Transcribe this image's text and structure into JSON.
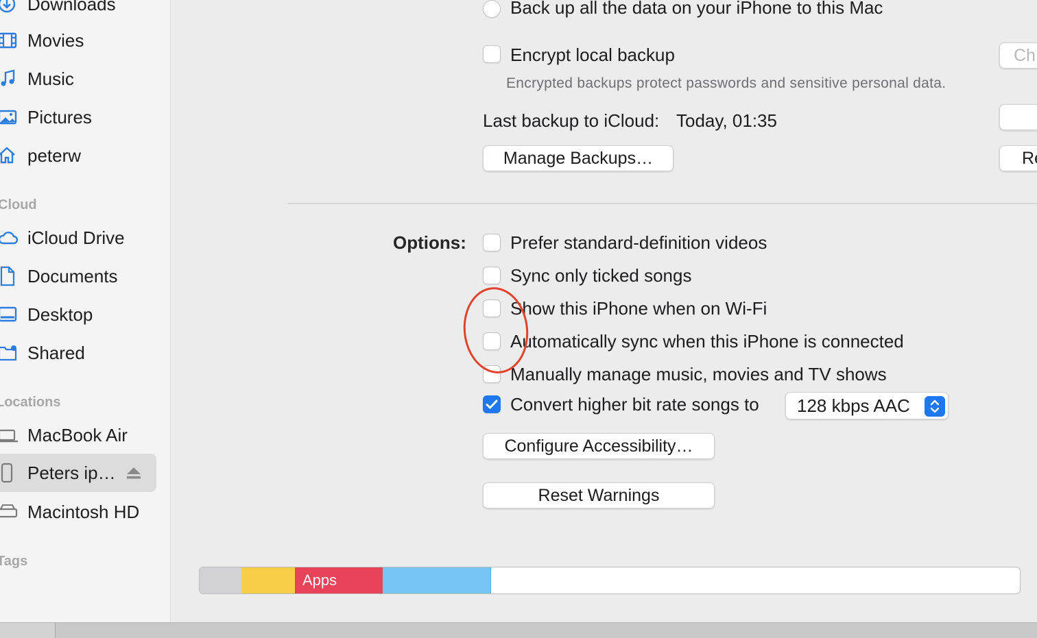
{
  "sidebar": {
    "items": [
      {
        "label": "Downloads",
        "icon": "download-icon"
      },
      {
        "label": "Movies",
        "icon": "film-icon"
      },
      {
        "label": "Music",
        "icon": "music-note-icon"
      },
      {
        "label": "Pictures",
        "icon": "photo-icon"
      },
      {
        "label": "peterw",
        "icon": "home-icon"
      }
    ],
    "cloud_header": "Cloud",
    "cloud_items": [
      {
        "label": "iCloud Drive",
        "icon": "cloud-icon"
      },
      {
        "label": "Documents",
        "icon": "document-icon"
      },
      {
        "label": "Desktop",
        "icon": "desktop-icon"
      },
      {
        "label": "Shared",
        "icon": "shared-folder-icon"
      }
    ],
    "locations_header": "Locations",
    "location_items": [
      {
        "label": "MacBook Air",
        "icon": "laptop-icon"
      },
      {
        "label": "Peters ip…",
        "icon": "iphone-icon",
        "selected": true
      },
      {
        "label": "Macintosh HD",
        "icon": "hard-drive-icon"
      }
    ],
    "tags_header": "Tags"
  },
  "backup": {
    "backup_mac_label": "Back up all the data on your iPhone to this Mac",
    "encrypt_label": "Encrypt local backup",
    "encrypt_desc": "Encrypted backups protect passwords and sensitive personal data.",
    "change_password_label": "Ch",
    "last_backup_label": "Last backup to iCloud:",
    "last_backup_value": "Today, 01:35",
    "manage_backups_label": "Manage Backups…",
    "restore_label": "Re"
  },
  "options": {
    "heading": "Options:",
    "items": [
      {
        "label": "Prefer standard-definition videos",
        "checked": false
      },
      {
        "label": "Sync only ticked songs",
        "checked": false
      },
      {
        "label": "Show this iPhone when on Wi-Fi",
        "checked": false
      },
      {
        "label": "Automatically sync when this iPhone is connected",
        "checked": false
      },
      {
        "label": "Manually manage music, movies and TV shows",
        "checked": false
      },
      {
        "label": "Convert higher bit rate songs to",
        "checked": true
      }
    ],
    "bitrate_value": "128 kbps AAC",
    "configure_accessibility_label": "Configure Accessibility…",
    "reset_warnings_label": "Reset Warnings"
  },
  "storage": {
    "segments": [
      {
        "label": "",
        "color": "#d1d1d6"
      },
      {
        "label": "",
        "color": "#f8cd48"
      },
      {
        "label": "Apps",
        "color": "#e9435a"
      },
      {
        "label": "",
        "color": "#78c4f5"
      }
    ]
  },
  "colors": {
    "accent": "#1f78f0",
    "annotation": "#e2412c"
  }
}
